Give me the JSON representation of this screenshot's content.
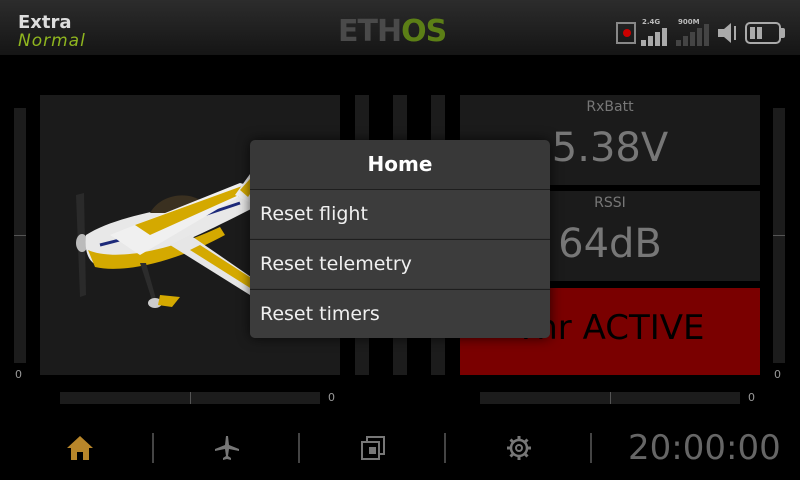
{
  "header": {
    "model_name": "Extra",
    "flight_mode": "Normal",
    "logo": {
      "part1": "ETH",
      "part2": "OS"
    },
    "signal": {
      "label_24": "2.4G",
      "label_900": "900M"
    }
  },
  "trims": {
    "left_vertical_value": "0",
    "right_vertical_value": "0",
    "left_horizontal_value": "0",
    "right_horizontal_value": "0"
  },
  "widgets": {
    "rxbatt": {
      "title": "RxBatt",
      "value": "5.38V"
    },
    "rssi": {
      "title": "RSSI",
      "value": "64dB"
    },
    "timer": {
      "text": "Thr ACTIVE"
    }
  },
  "dialog": {
    "title": "Home",
    "items": [
      {
        "label": "Reset flight"
      },
      {
        "label": "Reset telemetry"
      },
      {
        "label": "Reset timers"
      }
    ]
  },
  "footer": {
    "clock": "20:00:00",
    "icons": [
      "home-icon",
      "airplane-icon",
      "layers-icon",
      "gear-icon"
    ]
  },
  "colors": {
    "accent_green": "#8fb51f",
    "home_icon": "#b8862a",
    "timer_bg": "#7a0000"
  }
}
